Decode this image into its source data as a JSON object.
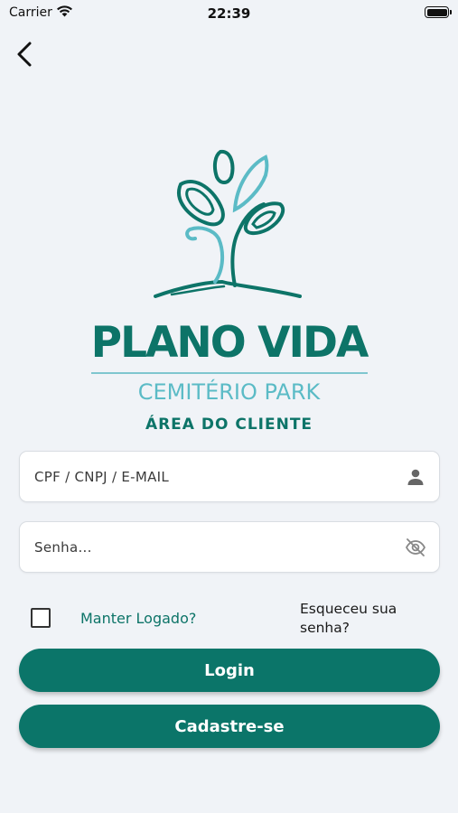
{
  "status_bar": {
    "carrier": "Carrier",
    "time": "22:39"
  },
  "brand": {
    "title": "PLANO VIDA",
    "subtitle": "CEMITÉRIO PARK",
    "area": "ÁREA DO CLIENTE",
    "colors": {
      "primary": "#0d7468",
      "accent": "#5bbbc6"
    }
  },
  "form": {
    "user_field": {
      "placeholder": "CPF / CNPJ / E-MAIL",
      "value": "",
      "icon": "person-icon"
    },
    "password_field": {
      "placeholder": "Senha...",
      "value": "",
      "icon": "eye-off-icon"
    },
    "keep_logged": {
      "label": "Manter Logado?",
      "checked": false
    },
    "forgot_password": "Esqueceu sua senha?",
    "login_label": "Login",
    "signup_label": "Cadastre-se"
  }
}
